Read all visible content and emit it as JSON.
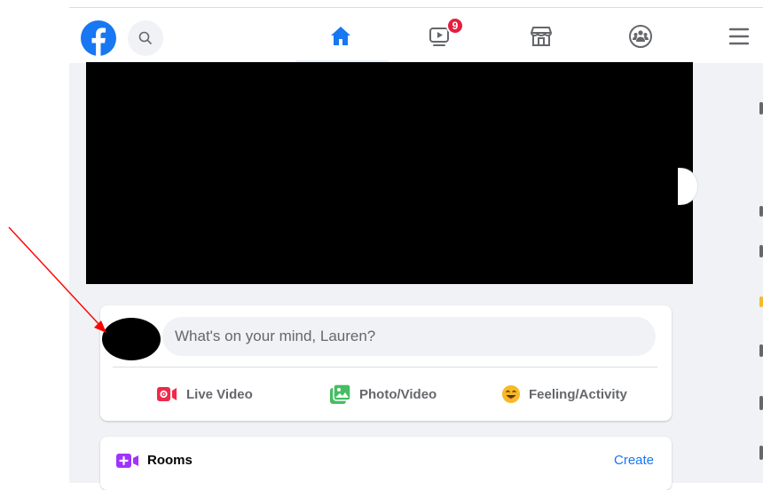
{
  "colors": {
    "brand": "#1877f2",
    "badge": "#e41e3f",
    "feed_bg": "#f0f2f5",
    "live_red": "#f02849",
    "photo_green": "#45bd62",
    "feeling_yellow": "#f7b928",
    "rooms_purple": "#a033ff",
    "annotation_arrow": "#ff0000"
  },
  "topbar": {
    "logo_icon": "facebook-logo-icon",
    "search_icon": "search-icon",
    "nav": [
      {
        "name": "home",
        "icon": "home-icon",
        "active": true
      },
      {
        "name": "watch",
        "icon": "video-play-icon",
        "badge": "9"
      },
      {
        "name": "marketplace",
        "icon": "marketplace-store-icon"
      },
      {
        "name": "groups",
        "icon": "groups-icon"
      },
      {
        "name": "menu",
        "icon": "hamburger-menu-icon"
      }
    ]
  },
  "composer": {
    "placeholder": "What's on your mind, Lauren?",
    "actions": [
      {
        "label": "Live Video",
        "icon": "live-video-icon"
      },
      {
        "label": "Photo/Video",
        "icon": "photo-icon"
      },
      {
        "label": "Feeling/Activity",
        "icon": "feeling-emoji-icon"
      }
    ]
  },
  "rooms": {
    "title": "Rooms",
    "create_label": "Create",
    "icon": "rooms-video-icon"
  }
}
